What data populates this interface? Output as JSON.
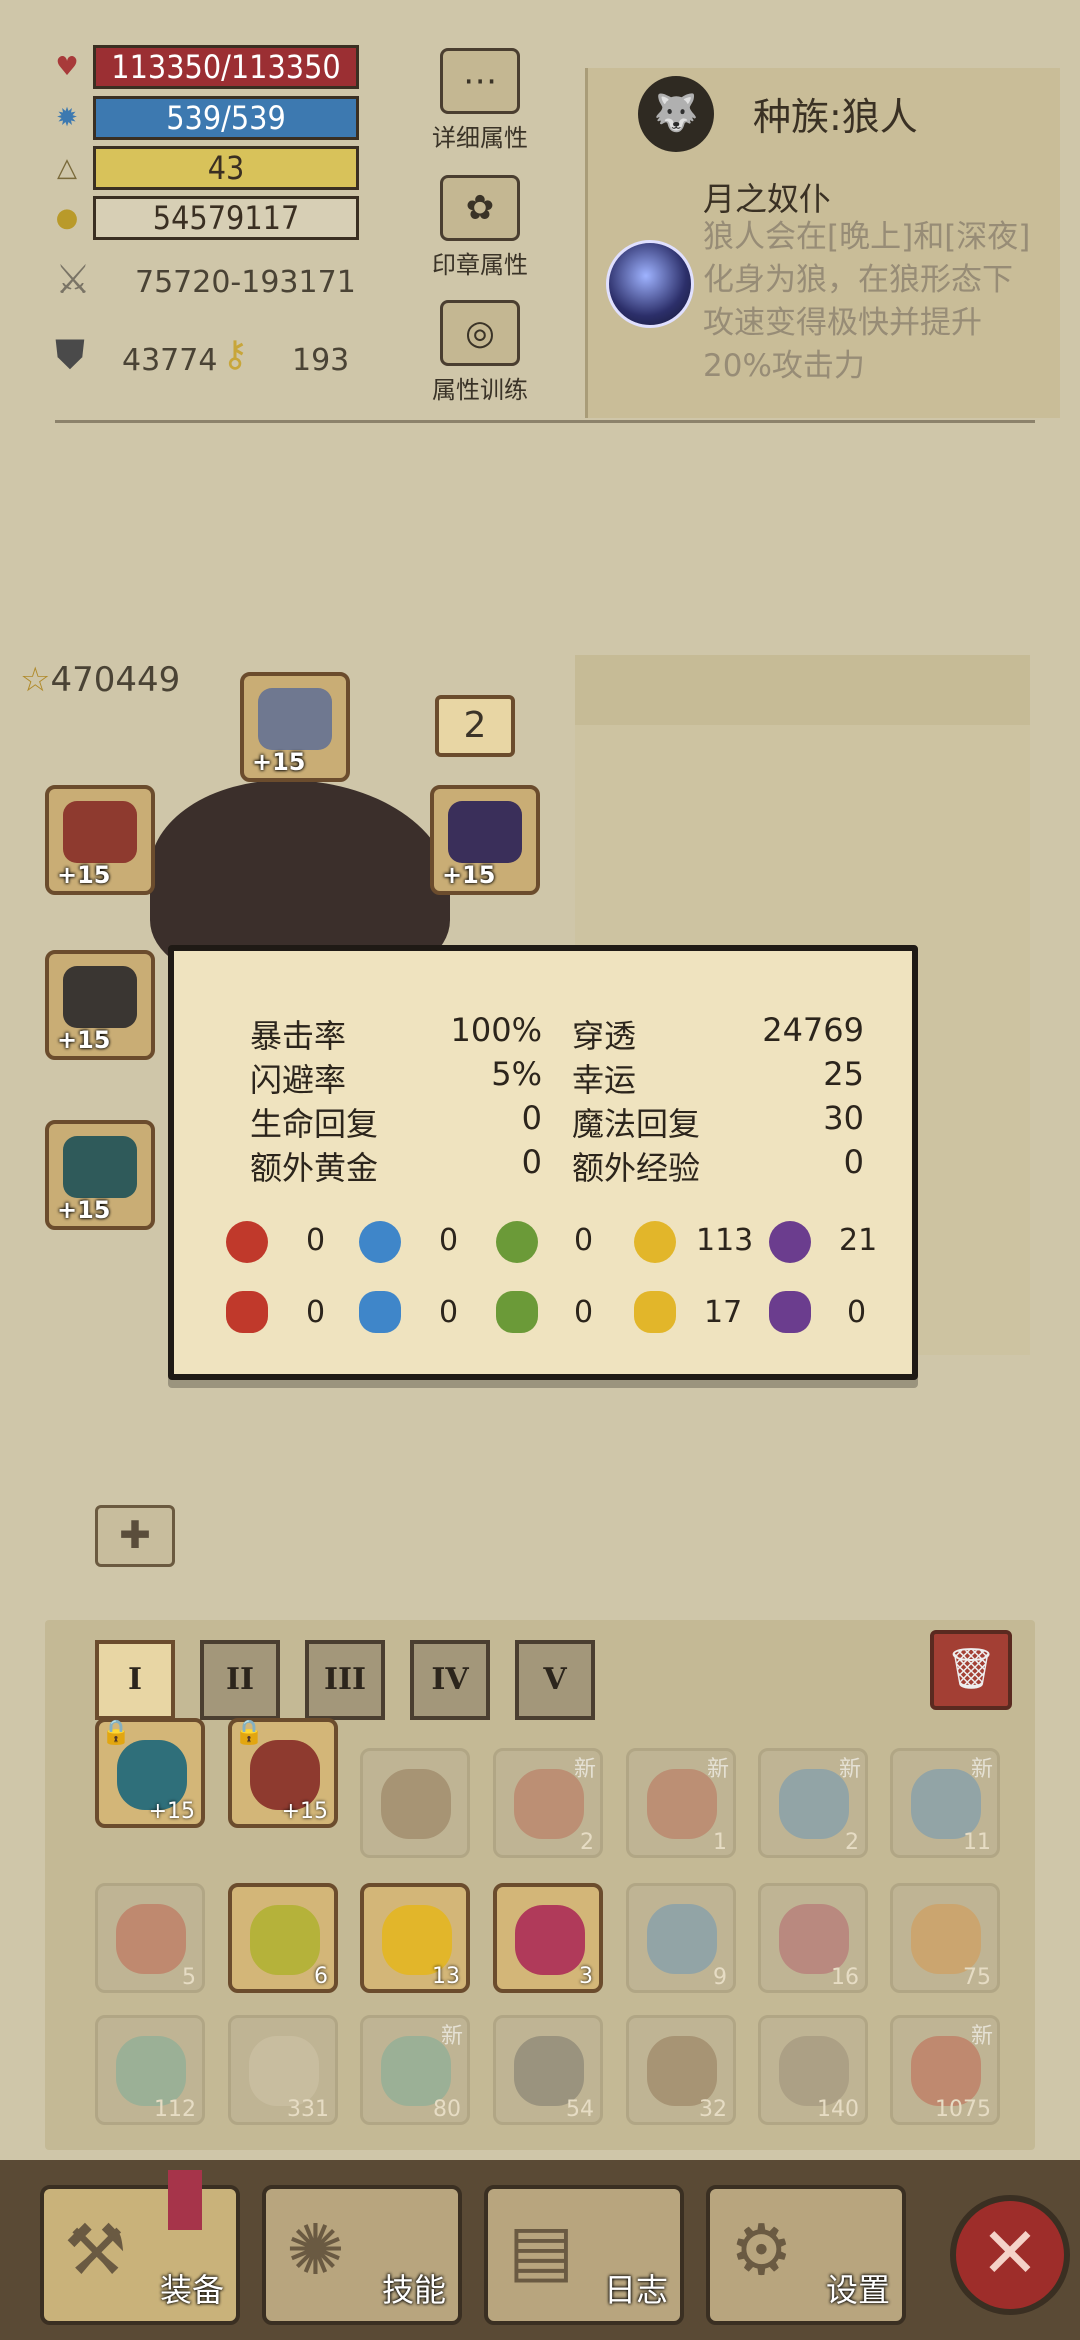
{
  "stats": {
    "hp": "113350/113350",
    "mp": "539/539",
    "level": "43",
    "gold": "54579117",
    "attack": "75720-193171",
    "defense": "43774",
    "keys": "193"
  },
  "side_buttons": {
    "detail": "详细属性",
    "seal": "印章属性",
    "training": "属性训练"
  },
  "race": {
    "title": "种族:狼人",
    "skill_name": "月之奴仆",
    "skill_desc": "狼人会在[晚上]和[深夜]化身为狼，在狼形态下攻速变得极快并提升20%攻击力"
  },
  "power": "470449",
  "badge": "2",
  "equip_plus": [
    "+15",
    "+15",
    "+15",
    "+15",
    "+15",
    "+15"
  ],
  "popup": {
    "rows": [
      {
        "l1": "暴击率",
        "v1": "100%",
        "l2": "穿透",
        "v2": "24769"
      },
      {
        "l1": "闪避率",
        "v1": "5%",
        "l2": "幸运",
        "v2": "25"
      },
      {
        "l1": "生命回复",
        "v1": "0",
        "l2": "魔法回复",
        "v2": "30"
      },
      {
        "l1": "额外黄金",
        "v1": "0",
        "l2": "额外经验",
        "v2": "0"
      }
    ],
    "gems_top": [
      "0",
      "0",
      "0",
      "113",
      "21"
    ],
    "gems_bottom": [
      "0",
      "0",
      "0",
      "17",
      "0"
    ],
    "gem_colors": [
      "#c0392b",
      "#3f86c9",
      "#6b9a38",
      "#e2b62a",
      "#6b3d8e"
    ]
  },
  "tabs": [
    "I",
    "II",
    "III",
    "IV",
    "V"
  ],
  "inventory": {
    "row1": [
      "+15",
      "+15",
      "",
      "2",
      "1",
      "2",
      "11"
    ],
    "row2": [
      "5",
      "6",
      "13",
      "3",
      "9",
      "16",
      "75"
    ],
    "row3": [
      "112",
      "331",
      "80",
      "54",
      "32",
      "140",
      "1075"
    ],
    "new_label": "新"
  },
  "nav": {
    "equip": "装备",
    "skills": "技能",
    "log": "日志",
    "settings": "设置"
  }
}
